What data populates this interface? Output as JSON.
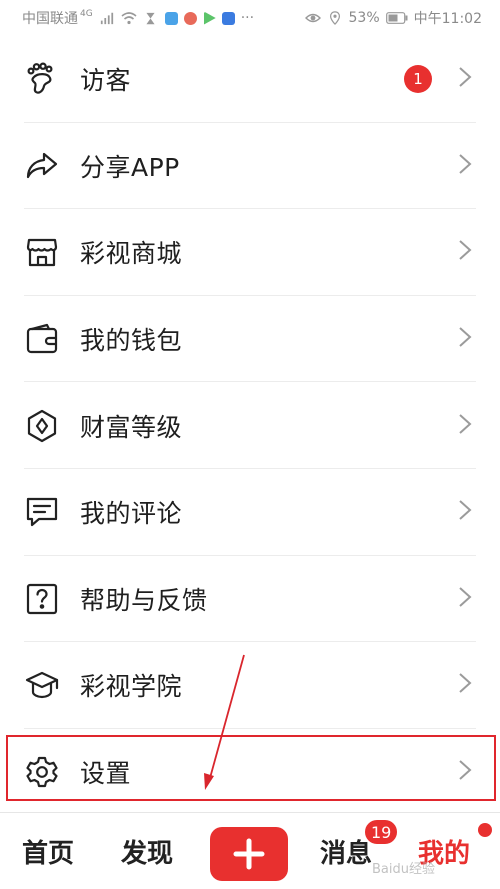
{
  "status_bar": {
    "carrier": "中国联通",
    "network": "4G",
    "battery": "53%",
    "time": "中午11:02"
  },
  "menu": {
    "items": [
      {
        "label": "访客",
        "icon": "footprint-icon",
        "badge": "1"
      },
      {
        "label": "分享APP",
        "icon": "share-icon"
      },
      {
        "label": "彩视商城",
        "icon": "store-icon"
      },
      {
        "label": "我的钱包",
        "icon": "wallet-icon"
      },
      {
        "label": "财富等级",
        "icon": "diamond-level-icon"
      },
      {
        "label": "我的评论",
        "icon": "comment-icon"
      },
      {
        "label": "帮助与反馈",
        "icon": "help-icon"
      },
      {
        "label": "彩视学院",
        "icon": "graduation-cap-icon"
      },
      {
        "label": "设置",
        "icon": "gear-icon"
      }
    ]
  },
  "bottom_nav": {
    "home": "首页",
    "discover": "发现",
    "messages": "消息",
    "messages_badge": "19",
    "mine": "我的"
  },
  "watermark": "Baidu经验",
  "colors": {
    "accent": "#e8302f",
    "text": "#1f1f1f",
    "chevron": "#9b9b9b"
  }
}
